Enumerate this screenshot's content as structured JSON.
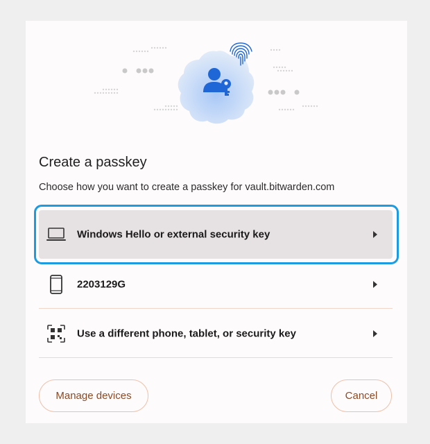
{
  "dialog": {
    "title": "Create a passkey",
    "subtitle": "Choose how you want to create a passkey for vault.bitwarden.com"
  },
  "hero": {
    "icon": "passkey-user-key-icon",
    "badge_icon": "fingerprint-icon"
  },
  "options": [
    {
      "label": "Windows Hello or external security key",
      "icon": "laptop-icon",
      "selected": true
    },
    {
      "label": "2203129G",
      "icon": "phone-icon",
      "selected": false
    },
    {
      "label": "Use a different phone, tablet, or security key",
      "icon": "qr-code-icon",
      "selected": false
    }
  ],
  "buttons": {
    "manage_devices": "Manage devices",
    "cancel": "Cancel"
  },
  "colors": {
    "focus_ring": "#1c9be0",
    "selected_bg": "#e6e1e3",
    "button_text": "#8a4a26",
    "button_border": "#eec0a8",
    "icon_blue": "#1f66d6"
  }
}
